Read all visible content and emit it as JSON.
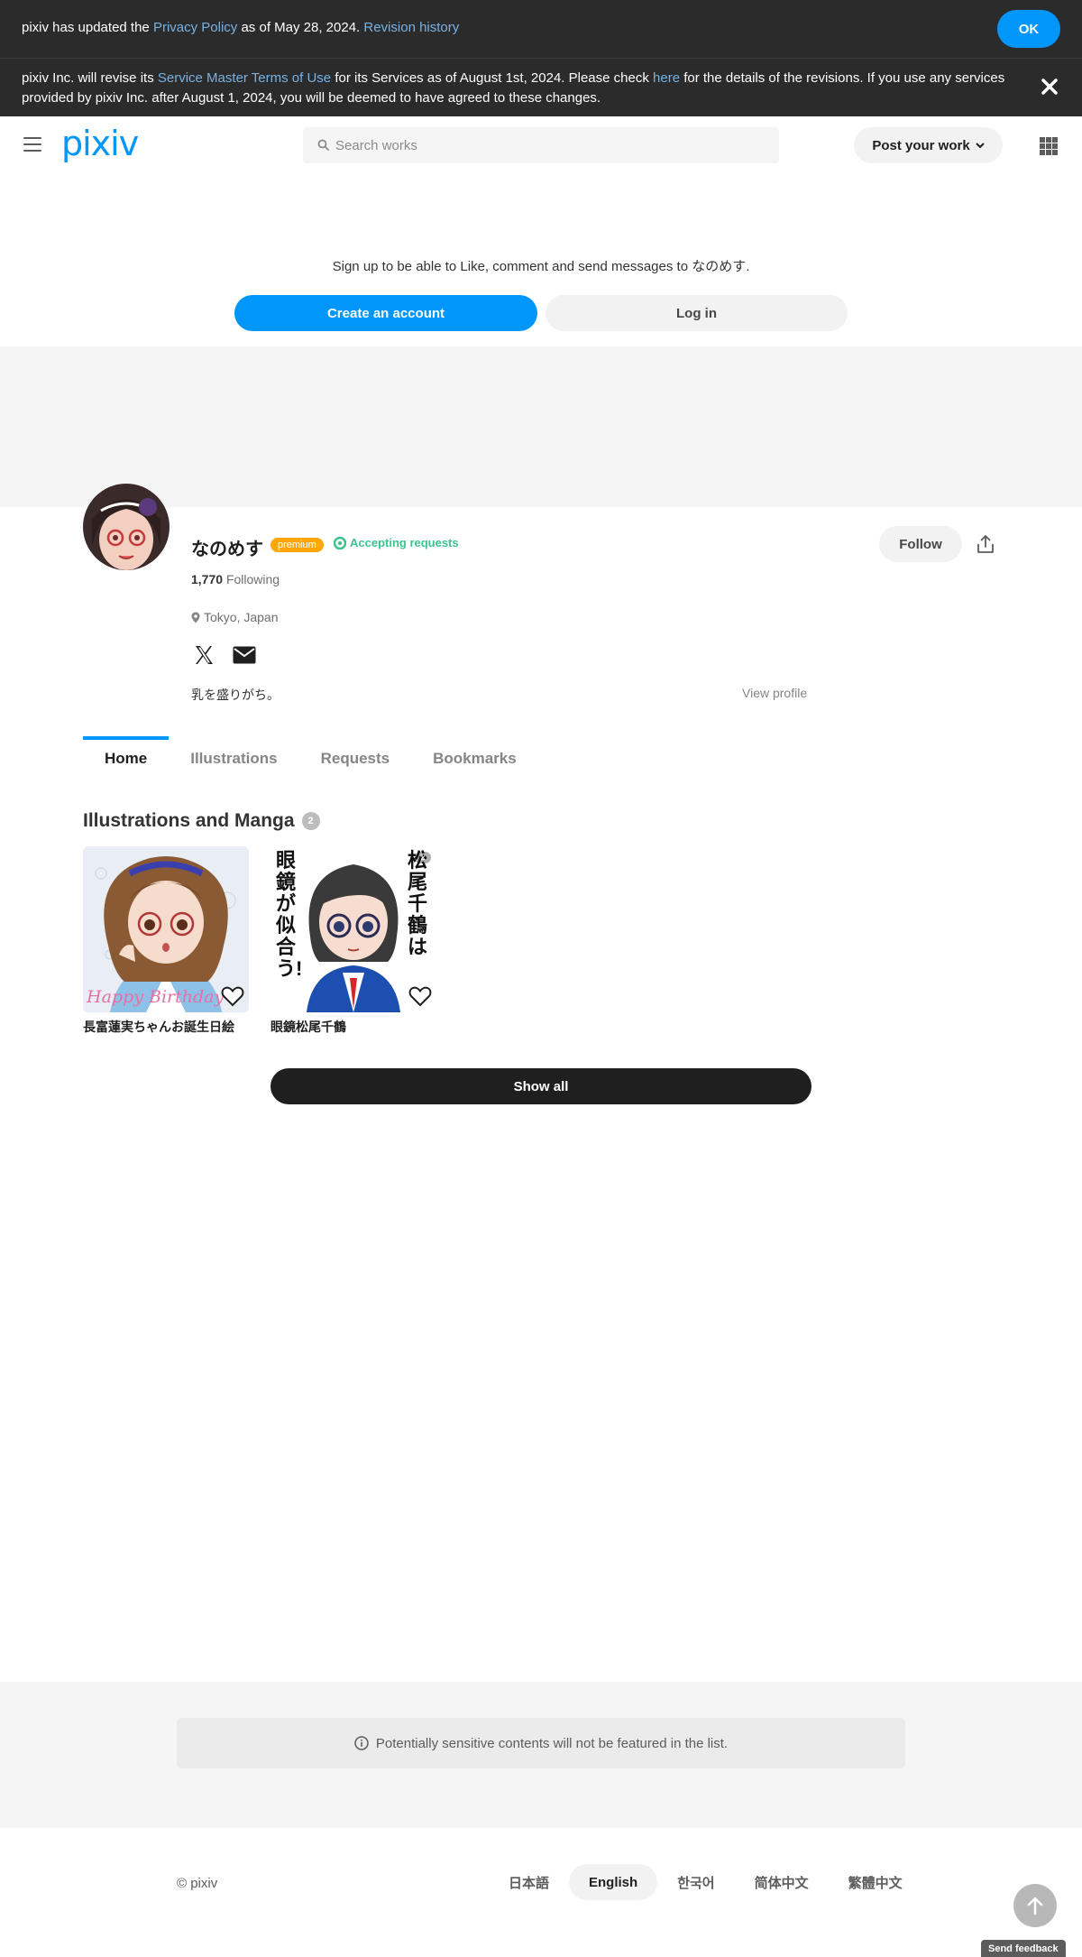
{
  "notice_privacy": {
    "prefix": "pixiv has updated the ",
    "privacy_link": "Privacy Policy",
    "middle": " as of May 28, 2024. ",
    "revision_link": "Revision history",
    "ok_label": "OK"
  },
  "notice_terms": {
    "prefix": "pixiv Inc. will revise its ",
    "terms_link": "Service Master Terms of Use",
    "middle": " for its Services as of August 1st, 2024. Please check ",
    "here_link": "here",
    "suffix": " for the details of the revisions. If you use any services provided by pixiv Inc. after August 1, 2024, you will be deemed to have agreed to these changes."
  },
  "header": {
    "logo": "pixiv",
    "search_placeholder": "Search works",
    "post_label": "Post your work"
  },
  "signup": {
    "text": "Sign up to be able to Like, comment and send messages to なのめす.",
    "create_label": "Create an account",
    "login_label": "Log in"
  },
  "profile": {
    "name": "なのめす",
    "premium_badge": "premium",
    "accepting": "Accepting requests",
    "follow_label": "Follow",
    "following_count": "1,770",
    "following_label": "Following",
    "location": "Tokyo, Japan",
    "bio": "乳を盛りがち。",
    "view_profile": "View profile"
  },
  "tabs": [
    "Home",
    "Illustrations",
    "Requests",
    "Bookmarks"
  ],
  "works_section": {
    "title": "Illustrations and Manga",
    "count": "2",
    "works": [
      {
        "title": "長富蓮実ちゃんお誕生日絵",
        "caption": "Happy Birthday"
      },
      {
        "title": "眼鏡松尾千鶴",
        "pages": "2",
        "vertical_text_1": "松尾千鶴は",
        "vertical_text_2": "眼鏡が似合う!"
      }
    ],
    "show_all": "Show all"
  },
  "sensitive_note": "Potentially sensitive contents will not be featured in the list.",
  "footer": {
    "copyright": "© pixiv",
    "languages": [
      "日本語",
      "English",
      "한국어",
      "简体中文",
      "繁體中文"
    ],
    "feedback": "Send feedback"
  },
  "colors": {
    "accent": "#0096fa",
    "premium": "#ffa60a",
    "accepting": "#3cc48f",
    "dark_bar": "#2b2b2b"
  }
}
